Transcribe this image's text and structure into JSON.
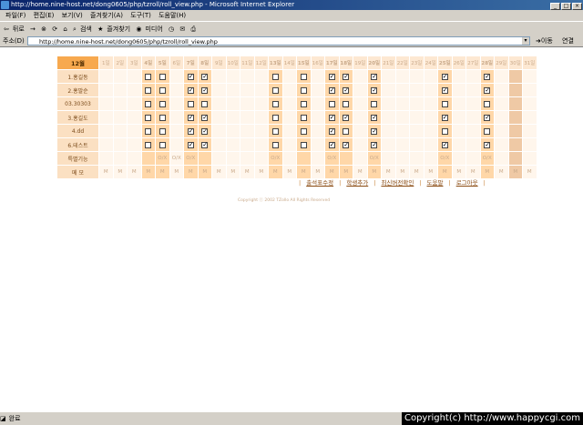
{
  "window": {
    "title": "http://home.nine-host.net/dong0605/php/tzroll/roll_view.php - Microsoft Internet Explorer"
  },
  "menu": [
    "파일(F)",
    "편집(E)",
    "보기(V)",
    "즐겨찾기(A)",
    "도구(T)",
    "도움말(H)"
  ],
  "toolbar": {
    "back": "뒤로",
    "forward": "→",
    "search": "검색",
    "favorites": "즐겨찾기",
    "media": "미디어"
  },
  "address": {
    "label": "주소(D)",
    "url": "http://home.nine-host.net/dong0605/php/tzroll/roll_view.php",
    "go": "이동",
    "links": "연결"
  },
  "calendar": {
    "month": "12월",
    "days": [
      "1일",
      "2일",
      "3일",
      "4일",
      "5일",
      "6일",
      "7일",
      "8일",
      "9일",
      "10일",
      "11일",
      "12일",
      "13일",
      "14일",
      "15일",
      "16일",
      "17일",
      "18일",
      "19일",
      "20일",
      "21일",
      "22일",
      "23일",
      "24일",
      "25일",
      "26일",
      "27일",
      "28일",
      "29일",
      "30일",
      "31일"
    ],
    "weekend_days": [
      4,
      5,
      7,
      8,
      13,
      15,
      17,
      18,
      20,
      25,
      28,
      30
    ],
    "today": 30,
    "check_days": [
      4,
      5,
      7,
      8,
      13,
      15,
      17,
      18,
      20,
      25,
      28
    ],
    "students": [
      {
        "name": "1.홍길동",
        "checked": [
          7,
          8,
          17,
          18,
          20,
          25,
          28
        ]
      },
      {
        "name": "2.홍말순",
        "checked": [
          7,
          8,
          17,
          18,
          20,
          25,
          28
        ]
      },
      {
        "name": "03.30303",
        "checked": []
      },
      {
        "name": "3.홍길도",
        "checked": [
          7,
          8,
          17,
          18,
          20,
          25,
          28
        ]
      },
      {
        "name": "4.dd",
        "checked": [
          7,
          8,
          17,
          20
        ]
      },
      {
        "name": "6.테스트",
        "checked": [
          7,
          8,
          17,
          18,
          20,
          25,
          28
        ]
      }
    ],
    "special_label": "특별기능",
    "special_mark": "O/X",
    "special_days": [
      5,
      6,
      7,
      13,
      17,
      20,
      25,
      28
    ],
    "memo_label": "메   모",
    "memo_mark": "M"
  },
  "footer_nav": [
    "출석표수정",
    "학생추가",
    "최신버전확인",
    "도움말",
    "로그아웃"
  ],
  "copyright": "Copyright ⓒ 2002 TZollo All Rights Reserved",
  "status": {
    "text": "완료",
    "watermark": "Copyright(c) http://www.happycgi.com"
  }
}
